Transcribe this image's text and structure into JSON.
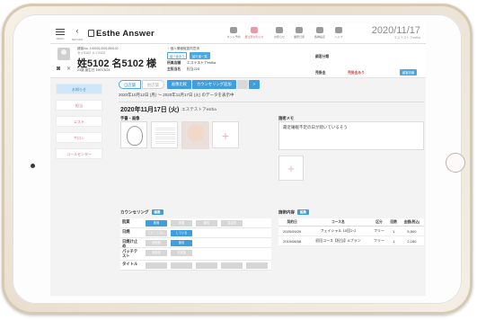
{
  "nav": {
    "menu_label": "MENU",
    "back_label": "RETURN",
    "logo": "Esthe Answer",
    "icons": [
      {
        "name": "reservation",
        "label": "ネット予約"
      },
      {
        "name": "alert",
        "label": "要注意お知らせ"
      },
      {
        "name": "notice",
        "label": "お知らせ"
      },
      {
        "name": "daily",
        "label": "業務日報"
      },
      {
        "name": "settings",
        "label": "各種設定"
      },
      {
        "name": "help",
        "label": "ヘルプ"
      }
    ],
    "date": "2020/11/17",
    "date_sub": "エステストアestha"
  },
  "customer": {
    "number": "顧客No. 1000012001050102",
    "kana": "セイ5102 メイ5102",
    "name": "姓5102 名5102 様",
    "info": "23歳  誕生日 1997/3/24",
    "consent_label": "・個人情報取扱同意済",
    "chip_intro": "紹介者あり",
    "chip_list": "紹介者一覧",
    "store_label": "所属店舗",
    "store_value": "エステストアestha",
    "staff_label": "主担当名",
    "staff_value": "担当225",
    "category_label": "顧客分類",
    "contract_label": "売掛金",
    "contract_warn": "売掛金あり",
    "detail_button": "顧客情報"
  },
  "sidebar": {
    "items": [
      "お知らせ",
      "担当",
      "エステ",
      "サロン",
      "コールセンター"
    ]
  },
  "main": {
    "tab_self": "自店舗",
    "tab_other": "他店舗",
    "btn_compare": "画像比較",
    "btn_counsel_add": "カウンセリング追加",
    "btn_next": ">",
    "range": "2020年10月12日 (月) 〜 2020年11月17日 (火) のデータを表示中",
    "day": "2020年11月17日 (火)",
    "day_store": "エステストアestha",
    "photos_title": "手書・画像",
    "memo_title": "施術メモ",
    "memo_text": "最近睡眠不足の日が続いているそう",
    "counsel_title": "カウンセリング",
    "edit_label": "編集",
    "history_title": "施術内容"
  },
  "counsel_rows": [
    {
      "label": "肌質",
      "options": [
        "乾燥",
        "普通",
        "脂性",
        "混合肌"
      ],
      "on": 0
    },
    {
      "label": "日焼",
      "options": [
        "したことない",
        "している"
      ],
      "on": 1
    },
    {
      "label": "日焼け止め",
      "options": [
        "使用無",
        "使用"
      ],
      "on": 1
    },
    {
      "label": "パッチテスト",
      "options": [
        "実施済",
        "未実施"
      ],
      "on": -1
    },
    {
      "label": "タイトル",
      "options": [
        "",
        "",
        "",
        "",
        ""
      ],
      "on": -1
    }
  ],
  "history": {
    "headers": [
      "契約日",
      "コース名",
      "区分",
      "回数",
      "金額(税込)"
    ],
    "rows": [
      [
        "2020/09/29",
        "フェイシャル 10回ｺｰｽ",
        "フリー",
        "1",
        "5,500"
      ],
      [
        "2019/08/08",
        "初回コース【担当】Aプラン",
        "フリー",
        "1",
        "2,160"
      ]
    ]
  }
}
